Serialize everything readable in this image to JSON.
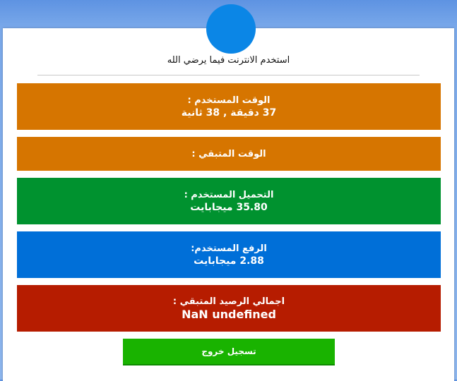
{
  "header": {
    "tagline": "استخدم الانترنت فيما يرضي الله"
  },
  "stats": {
    "time_used": {
      "label": "الوقت المستخدم :",
      "value": "37 دقيقة , 38 ثانية"
    },
    "time_remaining": {
      "label": "الوقت المتبقي :"
    },
    "download_used": {
      "label": "التحميل المستخدم :",
      "value": "35.80 ميجابايت"
    },
    "upload_used": {
      "label": "الرفع المستخدم:",
      "value": "2.88 ميجابايت"
    },
    "balance_remaining": {
      "label": "اجمالي الرصيد المتبقي :",
      "value": "NaN undefined"
    }
  },
  "actions": {
    "logout_label": "تسجيل خروج"
  },
  "colors": {
    "page_background": "#7aa9ea",
    "logo_circle": "#0b86e6",
    "time_boxes": "#d67500",
    "download_box": "#00922f",
    "upload_box": "#006fd8",
    "balance_box": "#b61c00",
    "logout_button": "#19b300"
  }
}
